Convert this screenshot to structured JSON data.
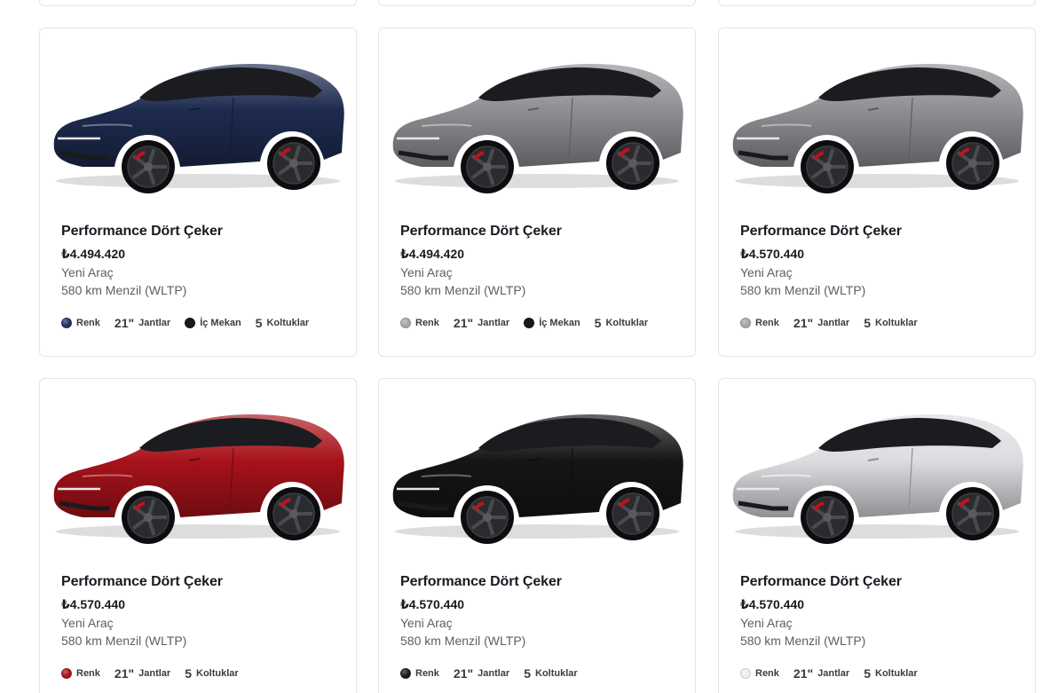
{
  "cards": [
    {
      "title": "Performance Dört Çeker",
      "price": "₺4.494.420",
      "condition": "Yeni Araç",
      "range": "580 km Menzil (WLTP)",
      "paint_color": "#1d2b4f",
      "swatch_color": "#1f3263",
      "specs": {
        "paint": "Renk",
        "wheel_size": "21\"",
        "wheels": "Jantlar",
        "interior": "İç Mekan",
        "seat_count": "5",
        "seats": "Koltuklar"
      },
      "interior_color": "#1a1a1a"
    },
    {
      "title": "Performance Dört Çeker",
      "price": "₺4.494.420",
      "condition": "Yeni Araç",
      "range": "580 km Menzil (WLTP)",
      "paint_color": "#8e8f93",
      "swatch_color": "#a4a5a8",
      "specs": {
        "paint": "Renk",
        "wheel_size": "21\"",
        "wheels": "Jantlar",
        "interior": "İç Mekan",
        "seat_count": "5",
        "seats": "Koltuklar"
      },
      "interior_color": "#1a1a1a"
    },
    {
      "title": "Performance Dört Çeker",
      "price": "₺4.570.440",
      "condition": "Yeni Araç",
      "range": "580 km Menzil (WLTP)",
      "paint_color": "#8e8f93",
      "swatch_color": "#a4a5a8",
      "specs": {
        "paint": "Renk",
        "wheel_size": "21\"",
        "wheels": "Jantlar",
        "seat_count": "5",
        "seats": "Koltuklar"
      }
    },
    {
      "title": "Performance Dört Çeker",
      "price": "₺4.570.440",
      "condition": "Yeni Araç",
      "range": "580 km Menzil (WLTP)",
      "paint_color": "#a8121a",
      "swatch_color": "#a3141c",
      "specs": {
        "paint": "Renk",
        "wheel_size": "21\"",
        "wheels": "Jantlar",
        "seat_count": "5",
        "seats": "Koltuklar"
      }
    },
    {
      "title": "Performance Dört Çeker",
      "price": "₺4.570.440",
      "condition": "Yeni Araç",
      "range": "580 km Menzil (WLTP)",
      "paint_color": "#151516",
      "swatch_color": "#1a1a1a",
      "specs": {
        "paint": "Renk",
        "wheel_size": "21\"",
        "wheels": "Jantlar",
        "seat_count": "5",
        "seats": "Koltuklar"
      }
    },
    {
      "title": "Performance Dört Çeker",
      "price": "₺4.570.440",
      "condition": "Yeni Araç",
      "range": "580 km Menzil (WLTP)",
      "paint_color": "#dcdde0",
      "swatch_color": "#eeeeee",
      "specs": {
        "paint": "Renk",
        "wheel_size": "21\"",
        "wheels": "Jantlar",
        "seat_count": "5",
        "seats": "Koltuklar"
      }
    }
  ]
}
